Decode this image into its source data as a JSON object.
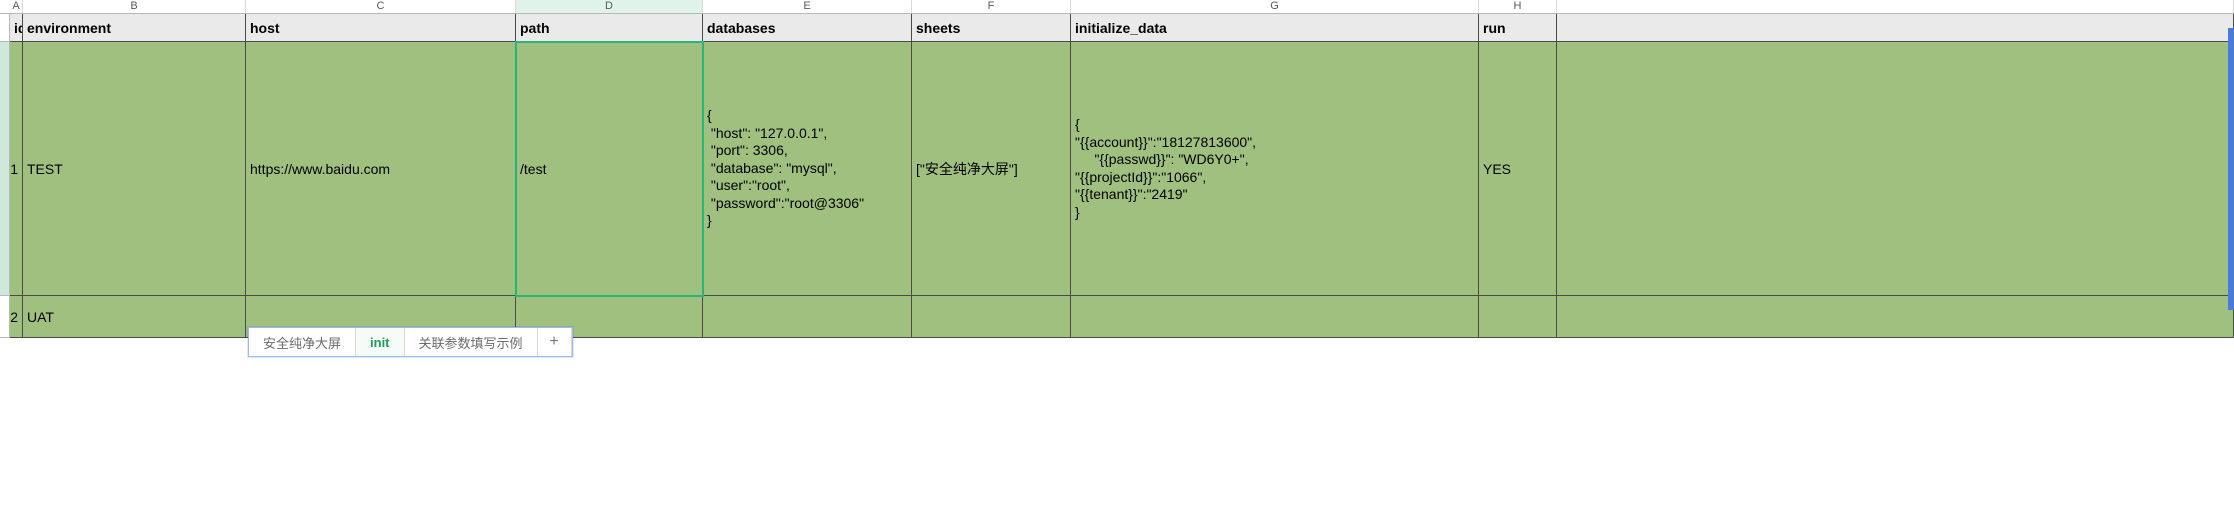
{
  "columns": {
    "A": "A",
    "B": "B",
    "C": "C",
    "D": "D",
    "E": "E",
    "F": "F",
    "G": "G",
    "H": "H"
  },
  "headers": {
    "A": "id",
    "B": "environment",
    "C": "host",
    "D": "path",
    "E": "databases",
    "F": "sheets",
    "G": "initialize_data",
    "H": "run"
  },
  "rows": [
    {
      "num": "1",
      "env": "TEST",
      "host": "https://www.baidu.com",
      "path": "/test",
      "databases": "{\n \"host\": \"127.0.0.1\",\n \"port\": 3306,\n \"database\": \"mysql\",\n \"user\":\"root\",\n \"password\":\"root@3306\"\n}",
      "sheets": "[\"安全纯净大屏\"]",
      "init_data": "{\n\"{{account}}\":\"18127813600\",\n     \"{{passwd}}\": \"WD6Y0+\",\n\"{{projectId}}\":\"1066\",\n\"{{tenant}}\":\"2419\"\n}",
      "run": "YES"
    },
    {
      "num": "2",
      "env": "UAT",
      "host": "",
      "path": "",
      "databases": "",
      "sheets": "",
      "init_data": "",
      "run": ""
    }
  ],
  "tabs": {
    "items": [
      "安全纯净大屏",
      "init",
      "关联参数填写示例"
    ],
    "active": "init",
    "add": "+"
  }
}
